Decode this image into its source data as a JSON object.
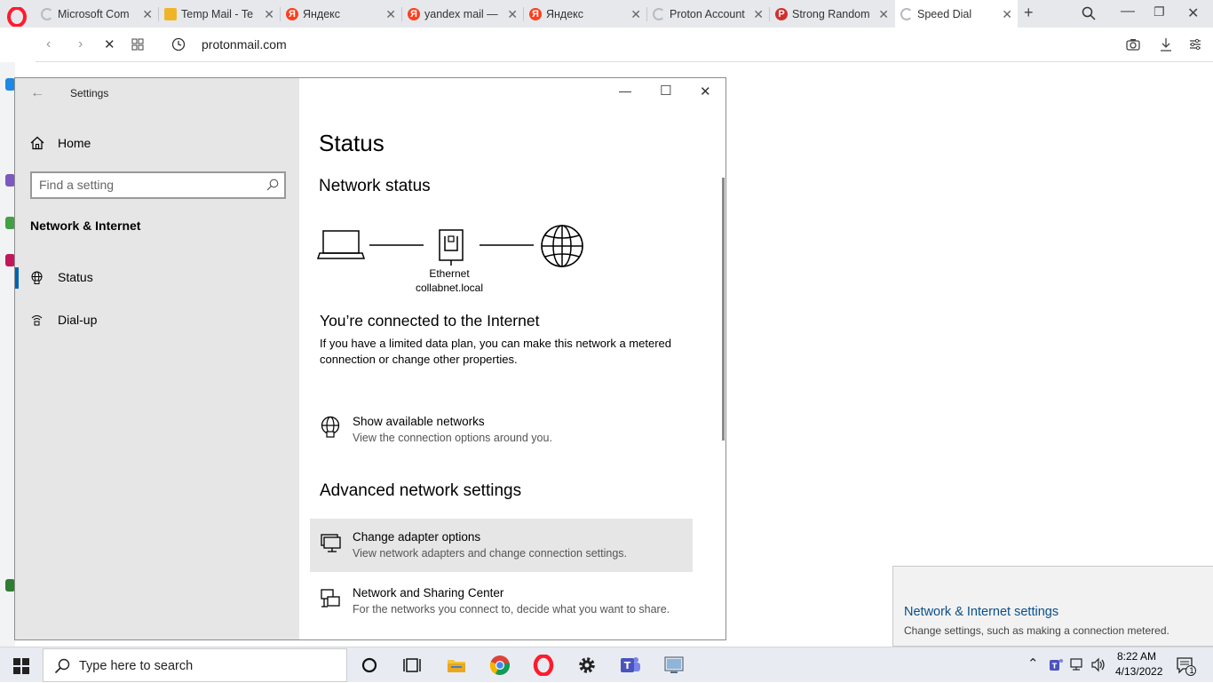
{
  "browser": {
    "tabs": [
      {
        "title": "Microsoft Com",
        "favicon": "loading-icon",
        "color": "#9aa0a6"
      },
      {
        "title": "Temp Mail - Te",
        "favicon": "mail-icon",
        "color": "#f0b429"
      },
      {
        "title": "Яндекс",
        "favicon": "yandex-icon",
        "color": "#fc3f1d"
      },
      {
        "title": "yandex mail —",
        "favicon": "yandex-icon",
        "color": "#fc3f1d"
      },
      {
        "title": "Яндекс",
        "favicon": "yandex-icon",
        "color": "#fc3f1d"
      },
      {
        "title": "Proton Account",
        "favicon": "loading-icon",
        "color": "#9aa0a6"
      },
      {
        "title": "Strong Random",
        "favicon": "password-icon",
        "color": "#d32f2f"
      },
      {
        "title": "Speed Dial",
        "favicon": "loading-icon",
        "color": "#9aa0a6"
      }
    ],
    "url": "protonmail.com"
  },
  "settings": {
    "window_title": "Settings",
    "home_label": "Home",
    "search_placeholder": "Find a setting",
    "section": "Network & Internet",
    "nav": [
      {
        "label": "Status",
        "icon": "globe-icon",
        "selected": true
      },
      {
        "label": "Dial-up",
        "icon": "dialup-icon",
        "selected": false
      }
    ],
    "page_title": "Status",
    "network_status": "Network status",
    "adapter_name": "Ethernet",
    "adapter_domain": "collabnet.local",
    "connected_title": "You’re connected to the Internet",
    "connected_desc": "If you have a limited data plan, you can make this network a metered connection or change other properties.",
    "show_networks": {
      "title": "Show available networks",
      "desc": "View the connection options around you."
    },
    "advanced_head": "Advanced network settings",
    "change_adapter": {
      "title": "Change adapter options",
      "desc": "View network adapters and change connection settings."
    },
    "sharing_center": {
      "title": "Network and Sharing Center",
      "desc": "For the networks you connect to, decide what you want to share."
    }
  },
  "toast": {
    "title": "Network & Internet settings",
    "desc": "Change settings, such as making a connection metered."
  },
  "taskbar": {
    "search_placeholder": "Type here to search",
    "time": "8:22 AM",
    "date": "4/13/2022",
    "notification_count": "1"
  },
  "colors": {
    "accent": "#0063b1",
    "toast_link": "#0b4f8a",
    "opera_red": "#ff1b2d"
  }
}
